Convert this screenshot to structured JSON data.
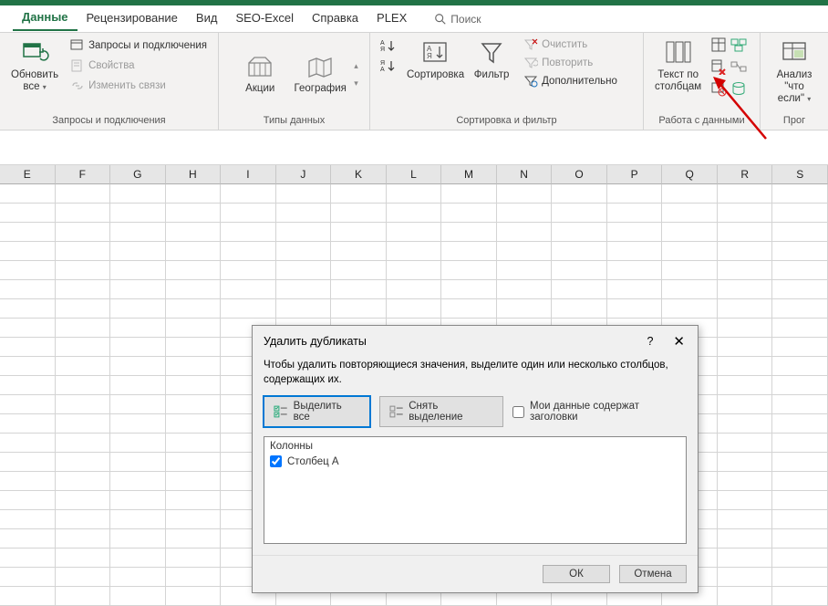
{
  "tabs": [
    "Данные",
    "Рецензирование",
    "Вид",
    "SEO-Excel",
    "Справка",
    "PLEX"
  ],
  "search": {
    "placeholder": "Поиск"
  },
  "ribbon": {
    "g1": {
      "refresh": "Обновить",
      "refresh2": "все",
      "queries": "Запросы и подключения",
      "props": "Свойства",
      "links": "Изменить связи",
      "label": "Запросы и подключения"
    },
    "g2": {
      "stocks": "Акции",
      "geo": "География",
      "label": "Типы данных"
    },
    "g3": {
      "sort": "Сортировка",
      "filter": "Фильтр",
      "clear": "Очистить",
      "reapply": "Повторить",
      "advanced": "Дополнительно",
      "label": "Сортировка и фильтр"
    },
    "g4": {
      "text": "Текст по",
      "text2": "столбцам",
      "label": "Работа с данными"
    },
    "g5": {
      "whatif": "Анализ \"что",
      "whatif2": "если\"",
      "label": "Прог"
    }
  },
  "columns": [
    "E",
    "F",
    "G",
    "H",
    "I",
    "J",
    "K",
    "L",
    "M",
    "N",
    "O",
    "P",
    "Q",
    "R",
    "S"
  ],
  "dialog": {
    "title": "Удалить дубликаты",
    "help": "?",
    "desc": "Чтобы удалить повторяющиеся значения, выделите один или несколько столбцов, содержащих их.",
    "select_all": "Выделить все",
    "unselect": "Снять выделение",
    "headers_check": "Мои данные содержат заголовки",
    "list_header": "Колонны",
    "col_item": "Столбец A",
    "ok": "ОК",
    "cancel": "Отмена"
  }
}
